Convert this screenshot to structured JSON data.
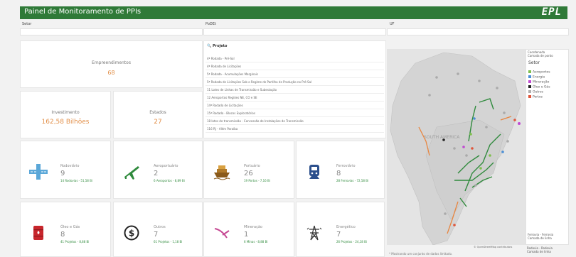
{
  "header": {
    "title": "Painel de Monitoramento de PPIs",
    "logo": "EPL"
  },
  "filters": {
    "setor": "Setor",
    "poder": "PoDEt",
    "uf": "UF"
  },
  "kpis": {
    "empreendimentos": {
      "label": "Empreendimentos",
      "value": "68"
    },
    "investimento": {
      "label": "Investimento",
      "value": "162,58 Bilhões"
    },
    "estados": {
      "label": "Estados",
      "value": "27"
    }
  },
  "projects": {
    "header": "Projeto",
    "items": [
      "4ª Rodada - Pré-Sal",
      "4ª Rodada de Licitações",
      "5ª Rodada - Acumulações Marginais",
      "5ª Rodada de Licitações Sob o Regime de Partilha de Produção no Pré-Sal",
      "11 Lotes de Linhas de Transmissão e Subestação",
      "12 Aeroportos Regiões NE, CO e SE",
      "14ª Rodada de Licitações",
      "15ª Rodada - Blocos Exploratórios",
      "18 lotes de transmissão - Concessão de Instalações de Transmissão",
      "116 RJ - Além Paraíba"
    ]
  },
  "sectors": [
    {
      "title": "Rodoviário",
      "count": "9",
      "sub": "14 Rodovias - 51,58 Bi",
      "icon": "highway-icon"
    },
    {
      "title": "Aeroportuário",
      "count": "2",
      "sub": "6 Aeroportos - 8,89 Bi",
      "icon": "airplane-icon"
    },
    {
      "title": "Portuário",
      "count": "26",
      "sub": "19 Portos - 7,16 Bi",
      "icon": "ship-icon"
    },
    {
      "title": "Ferroviário",
      "count": "8",
      "sub": "28 Ferrovias - 72,58 Bi",
      "icon": "train-icon"
    },
    {
      "title": "Óleo e Gás",
      "count": "8",
      "sub": "41 Projetos - 8,88 Bi",
      "icon": "oil-barrel-icon"
    },
    {
      "title": "Outros",
      "count": "7",
      "sub": "61 Projetos - 1,18 Bi",
      "icon": "dollar-icon"
    },
    {
      "title": "Mineração",
      "count": "1",
      "sub": "6 Minas - 8,88 Bi",
      "icon": "pickaxe-icon"
    },
    {
      "title": "Energético",
      "count": "7",
      "sub": "26 Projetos - 24,18 Bi",
      "icon": "power-tower-icon"
    }
  ],
  "legend": {
    "top1": "Coordenada",
    "top2": "Camada de ponto",
    "title": "Setor",
    "items": [
      {
        "label": "Aeroportos",
        "color": "#7fbf4d"
      },
      {
        "label": "Energia",
        "color": "#4b8fd6"
      },
      {
        "label": "Mineração",
        "color": "#c04ad1"
      },
      {
        "label": "Óleo e Gás",
        "color": "#222222"
      },
      {
        "label": "Outros",
        "color": "#b0b0b0"
      },
      {
        "label": "Portos",
        "color": "#e0553a"
      }
    ],
    "bottom1a": "Ferrovia - Ferrovia",
    "bottom1b": "Camada de linha",
    "bottom2a": "Rodovia - Rodovia",
    "bottom2b": "Camada de linha"
  },
  "map": {
    "label": "SOUTH AMERICA",
    "credit": "© OpenStreetMap contributors"
  },
  "footnote": "* Mostrando um conjunto de dados limitado."
}
